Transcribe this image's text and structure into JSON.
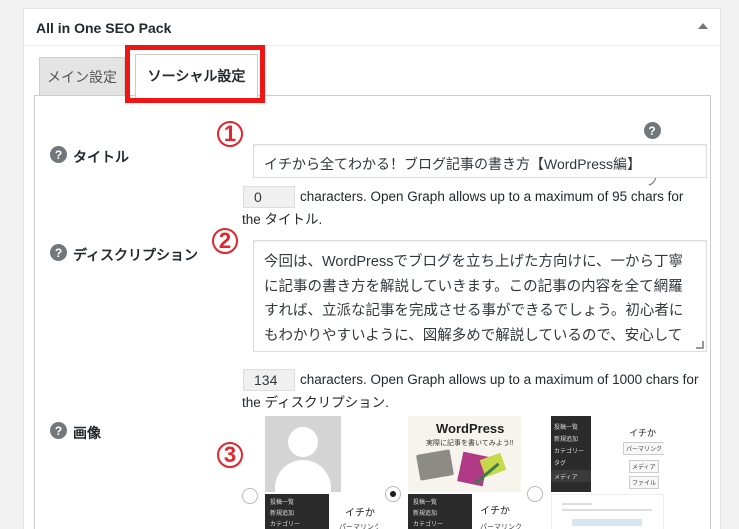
{
  "postbox": {
    "title": "All in One SEO Pack"
  },
  "tabs": [
    {
      "label": "メイン設定",
      "active": false
    },
    {
      "label": "ソーシャル設定",
      "active": true
    }
  ],
  "help": {
    "icon": "?",
    "label": "ヘルプ"
  },
  "fields": {
    "title": {
      "label": "タイトル",
      "badge": "1",
      "value": "イチから全てわかる！ブログ記事の書き方【WordPress編】",
      "count": "0",
      "hint_line1": "characters. Open Graph allows up to a maximum of 95 chars for",
      "hint_line2": "the タイトル."
    },
    "description": {
      "label": "ディスクリプション",
      "badge": "2",
      "value": "今回は、WordPressでブログを立ち上げた方向けに、一から丁寧に記事の書き方を解説していきます。この記事の内容を全て網羅すれば、立派な記事を完成させる事ができるでしょう。初心者にもわかりやすいように、図解多めで解説しているので、安心して読み進めていって",
      "count": "134",
      "hint_line1": "characters. Open Graph allows up to a maximum of 1000 chars for",
      "hint_line2": "the ディスクリプション."
    },
    "image": {
      "label": "画像",
      "badge": "3",
      "options": [
        {
          "name": "default-avatar",
          "selected": false
        },
        {
          "name": "wordpress-eyecatch",
          "selected": true,
          "title": "WordPress",
          "subtitle": "実際に記事を書いてみよう!!"
        },
        {
          "name": "admin-screenshot",
          "selected": false
        }
      ]
    }
  },
  "admin_menu": {
    "posts_list": "投稿一覧",
    "new_post": "新規追加",
    "category": "カテゴリー",
    "tag": "タグ",
    "media": "メディア",
    "permalink": "パーマリンク",
    "file": "ファイル",
    "snippet": "イチか"
  },
  "colors": {
    "highlight": "#f01414",
    "badge": "#e3242b",
    "help_icon": "#72777c"
  }
}
